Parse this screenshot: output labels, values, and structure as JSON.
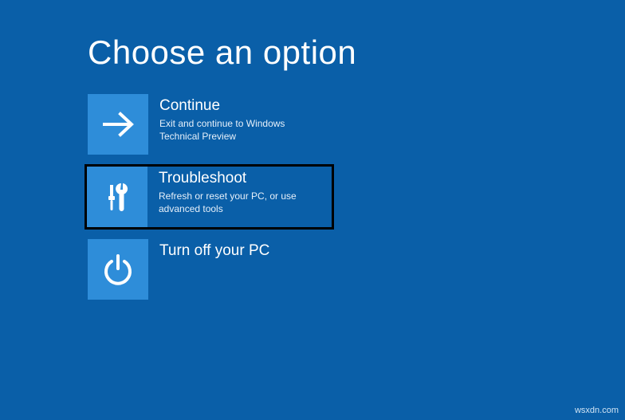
{
  "title": "Choose an option",
  "options": [
    {
      "icon": "arrow-right-icon",
      "title": "Continue",
      "desc": "Exit and continue to Windows Technical Preview"
    },
    {
      "icon": "tools-icon",
      "title": "Troubleshoot",
      "desc": "Refresh or reset your PC, or use advanced tools",
      "highlighted": true
    },
    {
      "icon": "power-icon",
      "title": "Turn off your PC",
      "desc": ""
    }
  ],
  "watermark": "wsxdn.com"
}
